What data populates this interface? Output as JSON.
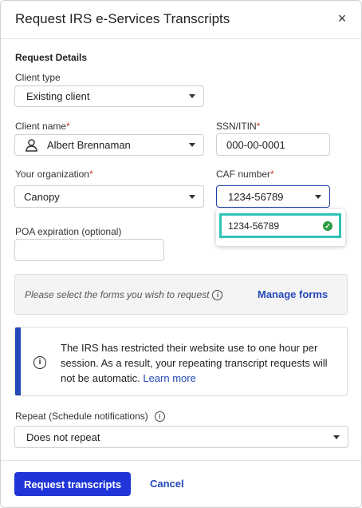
{
  "dialog": {
    "title": "Request IRS e-Services Transcripts",
    "close_label": "×"
  },
  "section": {
    "title": "Request Details"
  },
  "fields": {
    "client_type": {
      "label": "Client type",
      "value": "Existing client"
    },
    "client_name": {
      "label": "Client name",
      "required_mark": "*",
      "value": "Albert Brennaman"
    },
    "ssn": {
      "label": "SSN/ITIN",
      "required_mark": "*",
      "value": "000-00-0001"
    },
    "organization": {
      "label": "Your organization",
      "required_mark": "*",
      "value": "Canopy"
    },
    "caf": {
      "label": "CAF number",
      "required_mark": "*",
      "value": "1234-56789"
    },
    "poa": {
      "label": "POA expiration (optional)",
      "value": ""
    },
    "repeat": {
      "label": "Repeat (Schedule notifications)",
      "value": "Does not repeat"
    }
  },
  "caf_dropdown": {
    "options": [
      {
        "label": "1234-56789",
        "selected": true
      }
    ]
  },
  "forms": {
    "prompt": "Please select the forms you wish to request",
    "manage_label": "Manage forms"
  },
  "alert": {
    "text": "The IRS has restricted their website use to one hour per session. As a result, your repeating transcript requests will not be automatic.",
    "link": "Learn more"
  },
  "footer": {
    "submit_label": "Request transcripts",
    "cancel_label": "Cancel"
  },
  "colors": {
    "primary": "#2035d8",
    "link": "#2548b8",
    "highlight": "#2ec4b6",
    "success": "#2e9b44"
  }
}
